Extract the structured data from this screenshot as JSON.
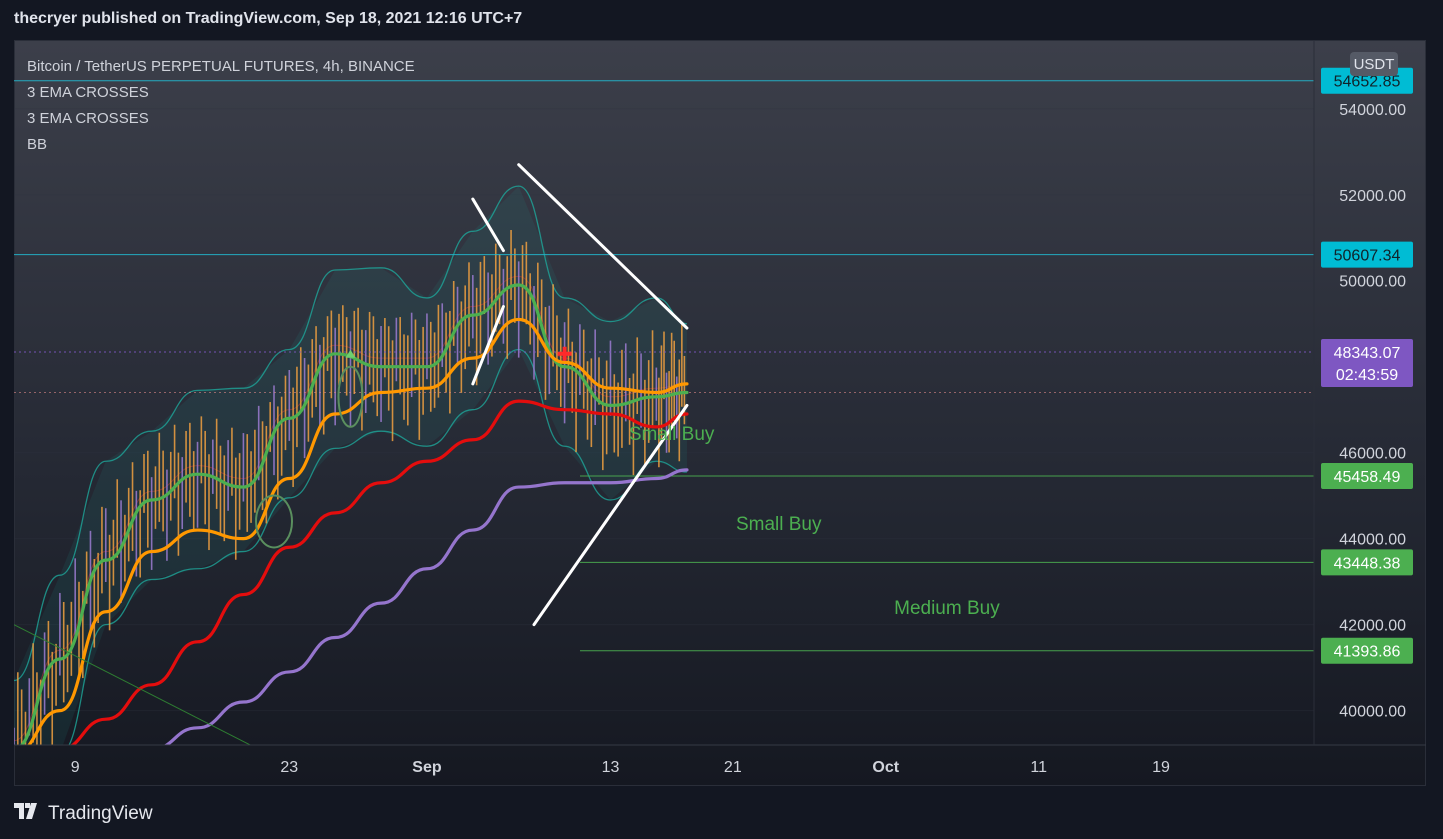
{
  "header": {
    "title": "thecryer published on TradingView.com, Sep 18, 2021 12:16 UTC+7"
  },
  "legend": {
    "symbol": "Bitcoin / TetherUS PERPETUAL FUTURES, 4h, BINANCE",
    "indicators": [
      "3 EMA CROSSES",
      "3 EMA CROSSES",
      "BB"
    ]
  },
  "footer": {
    "brand": "TradingView",
    "logo_icon": "tradingview-logo-icon"
  },
  "colors": {
    "ema_green": "#4caf50",
    "ema_orange": "#ff9800",
    "ema_red": "#e40d0d",
    "ema_purple": "#9575cd",
    "bb": "#1ea69a",
    "candle": "#f0a040",
    "annotation_white": "#ffffff",
    "level_line": "#4caf50",
    "hline_cyan": "#22b8cf",
    "badge_cyan": "#00bcd4",
    "badge_green": "#4caf50",
    "badge_purple": "#7e57c2"
  },
  "chart_data": {
    "type": "line",
    "title": "Bitcoin / TetherUS PERPETUAL FUTURES, 4h, BINANCE",
    "ylim": [
      39200,
      55600
    ],
    "currency_label": "USDT",
    "y_ticks": [
      "40000.00",
      "42000.00",
      "44000.00",
      "46000.00",
      "50000.00",
      "52000.00",
      "54000.00"
    ],
    "x_ticks": [
      "9",
      "23",
      "Sep",
      "13",
      "21",
      "Oct",
      "11",
      "19"
    ],
    "price_labels": [
      {
        "text": "54652.85",
        "value": 54652.85,
        "color": "cyan"
      },
      {
        "text": "50607.34",
        "value": 50607.34,
        "color": "cyan"
      },
      {
        "text": "48343.07",
        "value": 48343.07,
        "color": "purple",
        "sub": "02:43:59"
      },
      {
        "text": "45458.49",
        "value": 45458.49,
        "color": "green"
      },
      {
        "text": "43448.38",
        "value": 43448.38,
        "color": "green"
      },
      {
        "text": "41393.86",
        "value": 41393.86,
        "color": "green"
      }
    ],
    "annotations": [
      "Small Buy",
      "Small Buy",
      "Medium Buy"
    ],
    "series": [
      {
        "style": "ema-fast",
        "x": [
          "2021-08-05",
          "2021-08-08",
          "2021-08-11",
          "2021-08-14",
          "2021-08-17",
          "2021-08-20",
          "2021-08-23",
          "2021-08-26",
          "2021-08-29",
          "2021-09-01",
          "2021-09-04",
          "2021-09-07",
          "2021-09-10",
          "2021-09-13",
          "2021-09-16",
          "2021-09-18"
        ],
        "values": [
          39100,
          41200,
          43500,
          44900,
          45500,
          45200,
          46800,
          48300,
          48000,
          48000,
          49200,
          49900,
          48000,
          47100,
          47300,
          47400
        ]
      },
      {
        "style": "ema-mid",
        "x": [
          "2021-08-05",
          "2021-08-08",
          "2021-08-11",
          "2021-08-14",
          "2021-08-17",
          "2021-08-20",
          "2021-08-23",
          "2021-08-26",
          "2021-08-29",
          "2021-09-01",
          "2021-09-04",
          "2021-09-07",
          "2021-09-10",
          "2021-09-13",
          "2021-09-16",
          "2021-09-18"
        ],
        "values": [
          39000,
          40000,
          42300,
          43700,
          44200,
          44000,
          45400,
          46900,
          47400,
          47500,
          48200,
          49100,
          48100,
          47500,
          47400,
          47600
        ]
      },
      {
        "style": "ema-slow",
        "x": [
          "2021-08-05",
          "2021-08-08",
          "2021-08-11",
          "2021-08-14",
          "2021-08-17",
          "2021-08-20",
          "2021-08-23",
          "2021-08-26",
          "2021-08-29",
          "2021-09-01",
          "2021-09-04",
          "2021-09-07",
          "2021-09-10",
          "2021-09-13",
          "2021-09-16",
          "2021-09-18"
        ],
        "values": [
          38500,
          39100,
          39800,
          40600,
          41600,
          42700,
          43800,
          44600,
          45300,
          45800,
          46300,
          47200,
          47000,
          46900,
          46600,
          46900
        ]
      },
      {
        "style": "ema-long",
        "x": [
          "2021-08-05",
          "2021-08-08",
          "2021-08-11",
          "2021-08-14",
          "2021-08-17",
          "2021-08-20",
          "2021-08-23",
          "2021-08-26",
          "2021-08-29",
          "2021-09-01",
          "2021-09-04",
          "2021-09-07",
          "2021-09-10",
          "2021-09-13",
          "2021-09-16",
          "2021-09-18"
        ],
        "values": [
          37800,
          38200,
          38600,
          39100,
          39600,
          40200,
          40900,
          41700,
          42500,
          43300,
          44200,
          45200,
          45300,
          45300,
          45400,
          45600
        ]
      }
    ]
  }
}
